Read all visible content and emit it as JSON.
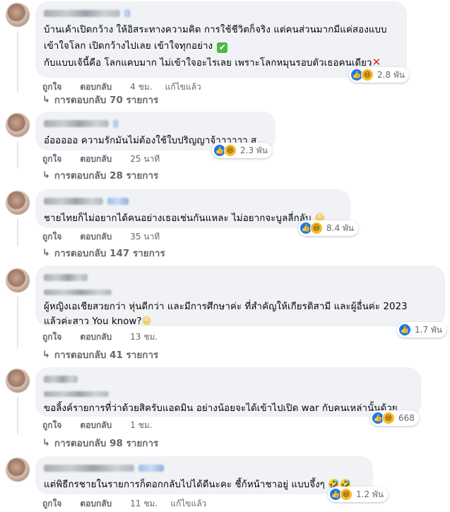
{
  "comments": [
    {
      "text_lines": [
        "บ้านเค้าเปิดกว้าง ให้อิสระทางความคิด การใช้ชีวิตก็จริง แต่คนส่วนมากมีแค่สองแบบ",
        "เข้าใจโลก เปิดกว้างไปเลย เข้าใจทุกอย่าง",
        "กับแบบเจ้นี้คือ โลกแคบมาก ไม่เข้าใจอะไรเลย เพราะโลกหมุนรอบตัวเธอคนเดียว"
      ],
      "reaction_count": "2.8 พัน",
      "like": "ถูกใจ",
      "reply": "ตอบกลับ",
      "time": "4 ชม.",
      "edited": "แก้ไขแล้ว",
      "replies_label": "การตอบกลับ 70 รายการ"
    },
    {
      "text_lines": [
        "อ๋อออออ ความรักมันไม่ต้องใช้ใบปริญญาจ้าาาาาา สู"
      ],
      "reaction_count": "2.3 พัน",
      "like": "ถูกใจ",
      "reply": "ตอบกลับ",
      "time": "25 นาที",
      "replies_label": "การตอบกลับ 28 รายการ"
    },
    {
      "text_lines": [
        "ชายไทยก็ไม่อยากได้คนอย่างเธอเช่นกันแหละ ไม่อยากจะบูลลี่กลับ"
      ],
      "reaction_count": "8.4 พัน",
      "like": "ถูกใจ",
      "reply": "ตอบกลับ",
      "time": "35 นาที",
      "replies_label": "การตอบกลับ 147 รายการ"
    },
    {
      "text_lines": [
        "ผู้หญิงเอเชียสวยกว่า หุ่นดีกว่า และมีการศึกษาค่ะ ที่สำคัญให้เกียรติสามี และผู้อื่นค่ะ 2023",
        "แล้วค่ะสาว You know?"
      ],
      "reaction_count": "1.7 พัน",
      "like": "ถูกใจ",
      "reply": "ตอบกลับ",
      "time": "13 ชม.",
      "replies_label": "การตอบกลับ 41 รายการ"
    },
    {
      "text_lines": [
        "ขอลิ้งค์รายการที่ว่าด้วยสิครับแอดมิน อย่างน้อยจะได้เข้าไปเปิด war กับคนเหล่านั้นด้วย"
      ],
      "reaction_count": "668",
      "like": "ถูกใจ",
      "reply": "ตอบกลับ",
      "time": "1 ชม.",
      "replies_label": "การตอบกลับ 98 รายการ"
    },
    {
      "text_lines": [
        "แต่พิธีกรชายในรายการก็ตอกกลับไปได้ดีนะคะ ชี้ก้หน้าชาอยู่ แบบจึ้งๆ"
      ],
      "reaction_count": "1.2 พัน",
      "like": "ถูกใจ",
      "reply": "ตอบกลับ",
      "time": "11 ชม.",
      "edited": "แก้ไขแล้ว"
    }
  ]
}
